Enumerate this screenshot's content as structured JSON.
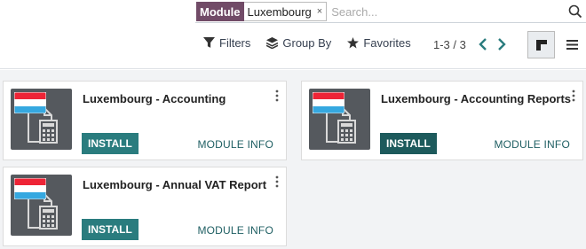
{
  "search": {
    "facet_category": "Module",
    "facet_value": "Luxembourg",
    "facet_remove": "×",
    "placeholder": "Search..."
  },
  "toolbar": {
    "filters_label": "Filters",
    "group_by_label": "Group By",
    "favorites_label": "Favorites"
  },
  "pager": {
    "value": "1-3 / 3"
  },
  "colors": {
    "brand": "#714b67",
    "install_button": "#2a7c7e",
    "install_button_hover": "#1d5a5c",
    "link": "#1f5f63",
    "background": "#f2f3f5"
  },
  "modules": [
    {
      "title": "Luxembourg - Accounting",
      "install_label": "INSTALL",
      "info_label": "MODULE INFO",
      "icon": "luxembourg-flag-calculator-icon"
    },
    {
      "title": "Luxembourg - Accounting Reports",
      "install_label": "INSTALL",
      "info_label": "MODULE INFO",
      "icon": "luxembourg-flag-calculator-icon"
    },
    {
      "title": "Luxembourg - Annual VAT Report",
      "install_label": "INSTALL",
      "info_label": "MODULE INFO",
      "icon": "luxembourg-flag-calculator-icon"
    }
  ]
}
